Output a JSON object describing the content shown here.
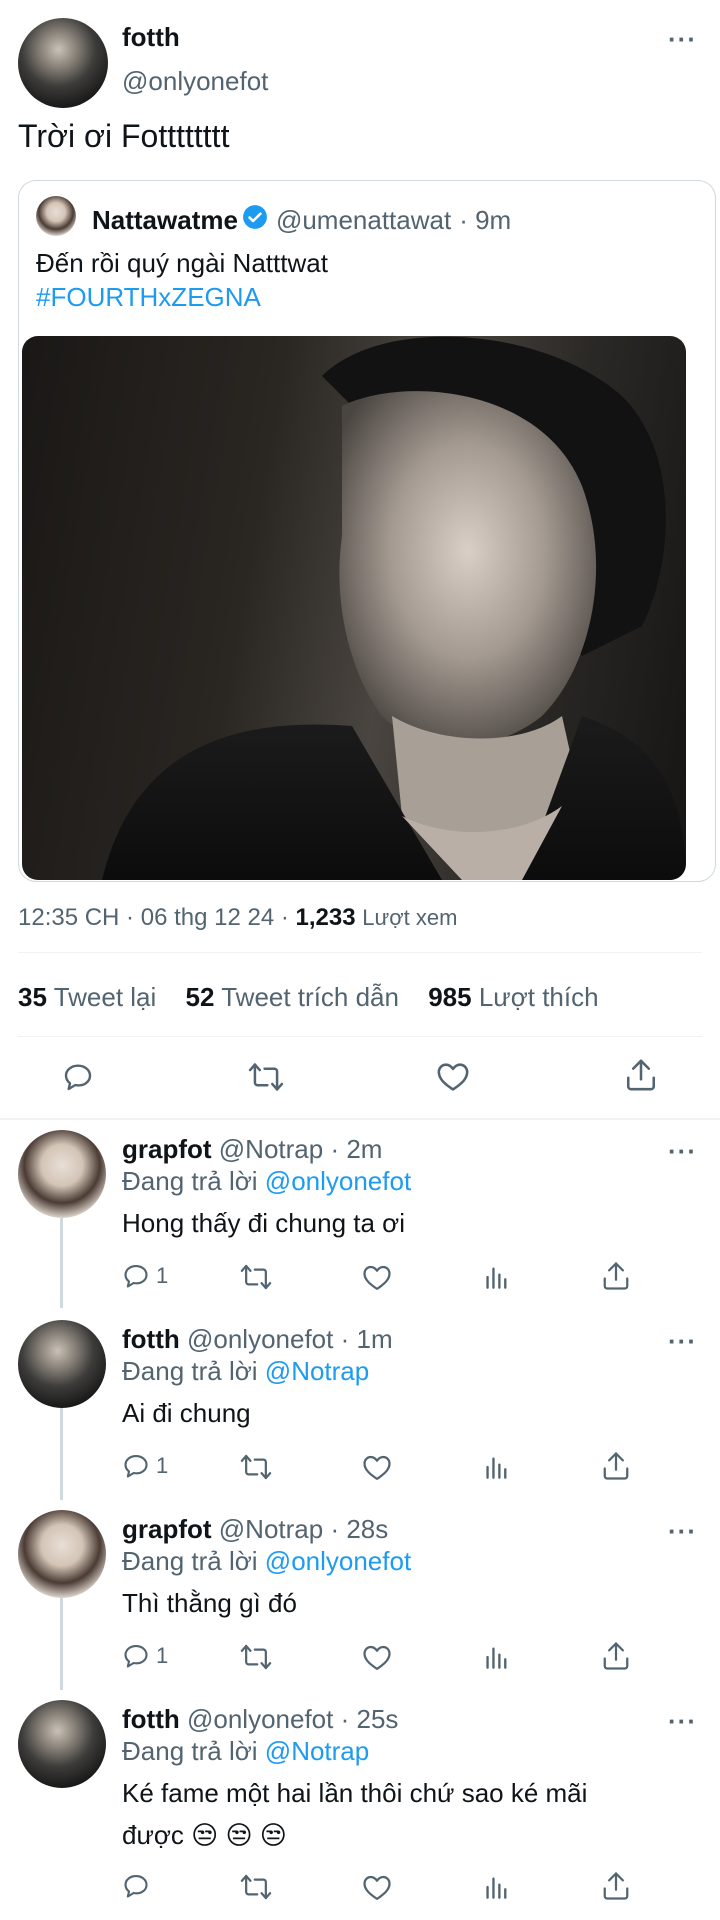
{
  "main_tweet": {
    "author_name": "fotth",
    "author_handle": "@onlyonefot",
    "text": "Trời ơi Fotttttttt",
    "meta_time": "12:35 CH · 06 thg 12 24 · ",
    "view_count": "1,233",
    "view_label": "Lượt xem"
  },
  "quoted_tweet": {
    "author_name": "Nattawatme",
    "author_handle": "@umenattawat",
    "time": "· 9m",
    "text": "Đến rồi quý ngài Natttwat",
    "hashtag": "#FOURTHxZEGNA"
  },
  "stats": {
    "retweets_count": "35",
    "retweets_label": "Tweet lại",
    "quotes_count": "52",
    "quotes_label": "Tweet trích dẫn",
    "likes_count": "985",
    "likes_label": "Lượt thích"
  },
  "replying_to_label": "Đang trả lời",
  "replies": [
    {
      "author_name": "grapfot",
      "author_handle": "@Notrap",
      "time": "· 2m",
      "reply_to": "@onlyonefot",
      "text": "Hong thấy đi chung ta ơi",
      "reply_count": "1"
    },
    {
      "author_name": "fotth",
      "author_handle": "@onlyonefot",
      "time": "· 1m",
      "reply_to": "@Notrap",
      "text": "Ai đi chung",
      "reply_count": "1"
    },
    {
      "author_name": "grapfot",
      "author_handle": "@Notrap",
      "time": "· 28s",
      "reply_to": "@onlyonefot",
      "text": "Thì thằng gì đó",
      "reply_count": "1"
    },
    {
      "author_name": "fotth",
      "author_handle": "@onlyonefot",
      "time": "· 25s",
      "reply_to": "@Notrap",
      "text": "Ké fame một hai lần thôi chứ sao ké mãi",
      "text_line2": "được 😒 😒 😒",
      "reply_count": ""
    }
  ],
  "icons": {
    "more": "more-icon",
    "reply": "reply-icon",
    "retweet": "retweet-icon",
    "like": "like-icon",
    "share": "share-icon",
    "analytics": "analytics-icon",
    "verified": "verified-badge-icon"
  },
  "colors": {
    "accent": "#1d9bf0",
    "text": "#0f1419",
    "muted": "#536471",
    "divider": "#eff3f4"
  }
}
